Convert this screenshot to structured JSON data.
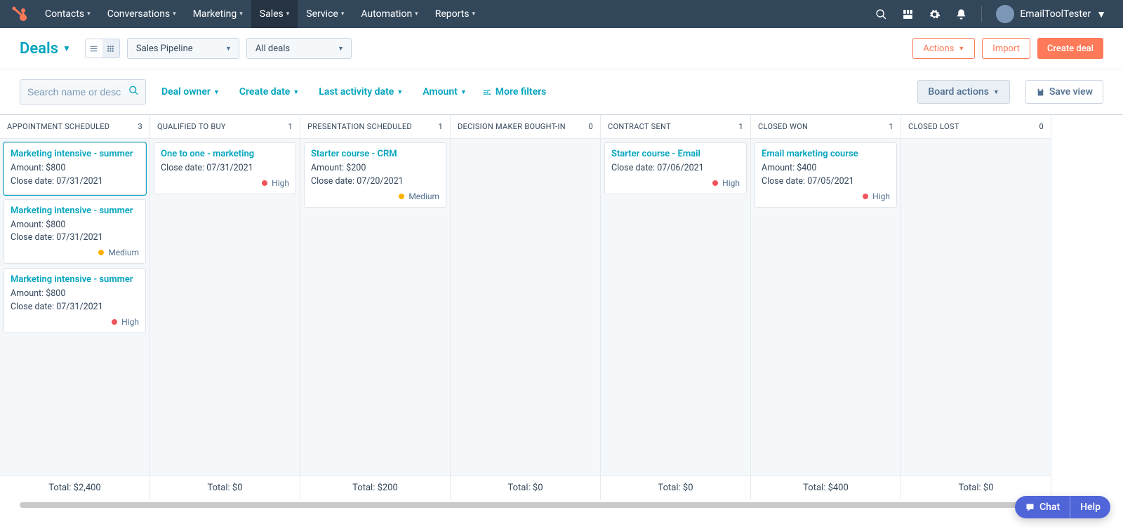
{
  "nav": {
    "items": [
      {
        "label": "Contacts"
      },
      {
        "label": "Conversations"
      },
      {
        "label": "Marketing"
      },
      {
        "label": "Sales"
      },
      {
        "label": "Service"
      },
      {
        "label": "Automation"
      },
      {
        "label": "Reports"
      }
    ],
    "active_index": 3,
    "account_name": "EmailToolTester"
  },
  "toolbar": {
    "title": "Deals",
    "pipeline_select": "Sales Pipeline",
    "deals_select": "All deals",
    "actions_label": "Actions",
    "import_label": "Import",
    "create_label": "Create deal"
  },
  "filters": {
    "search_placeholder": "Search name or description",
    "chips": [
      {
        "label": "Deal owner"
      },
      {
        "label": "Create date"
      },
      {
        "label": "Last activity date"
      },
      {
        "label": "Amount"
      }
    ],
    "more_label": "More filters",
    "board_actions_label": "Board actions",
    "save_view_label": "Save view"
  },
  "labels": {
    "amount": "Amount:",
    "close_date": "Close date:",
    "total_prefix": "Total: "
  },
  "board": {
    "columns": [
      {
        "title": "APPOINTMENT SCHEDULED",
        "count": "3",
        "total": "Total: $2,400",
        "cards": [
          {
            "title": "Marketing intensive - summer",
            "amount": "$800",
            "close": "07/31/2021",
            "priority": null,
            "active": true
          },
          {
            "title": "Marketing intensive - summer",
            "amount": "$800",
            "close": "07/31/2021",
            "priority": "Medium"
          },
          {
            "title": "Marketing intensive - summer",
            "amount": "$800",
            "close": "07/31/2021",
            "priority": "High"
          }
        ]
      },
      {
        "title": "QUALIFIED TO BUY",
        "count": "1",
        "total": "Total: $0",
        "cards": [
          {
            "title": "One to one - marketing",
            "amount": null,
            "close": "07/31/2021",
            "priority": "High"
          }
        ]
      },
      {
        "title": "PRESENTATION SCHEDULED",
        "count": "1",
        "total": "Total: $200",
        "cards": [
          {
            "title": "Starter course - CRM",
            "amount": "$200",
            "close": "07/20/2021",
            "priority": "Medium"
          }
        ]
      },
      {
        "title": "DECISION MAKER BOUGHT-IN",
        "count": "0",
        "total": "Total: $0",
        "cards": []
      },
      {
        "title": "CONTRACT SENT",
        "count": "1",
        "total": "Total: $0",
        "cards": [
          {
            "title": "Starter course - Email",
            "amount": null,
            "close": "07/06/2021",
            "priority": "High"
          }
        ]
      },
      {
        "title": "CLOSED WON",
        "count": "1",
        "total": "Total: $400",
        "cards": [
          {
            "title": "Email marketing course",
            "amount": "$400",
            "close": "07/05/2021",
            "priority": "High"
          }
        ]
      },
      {
        "title": "CLOSED LOST",
        "count": "0",
        "total": "Total: $0",
        "cards": []
      }
    ]
  },
  "help": {
    "chat": "Chat",
    "help": "Help"
  }
}
